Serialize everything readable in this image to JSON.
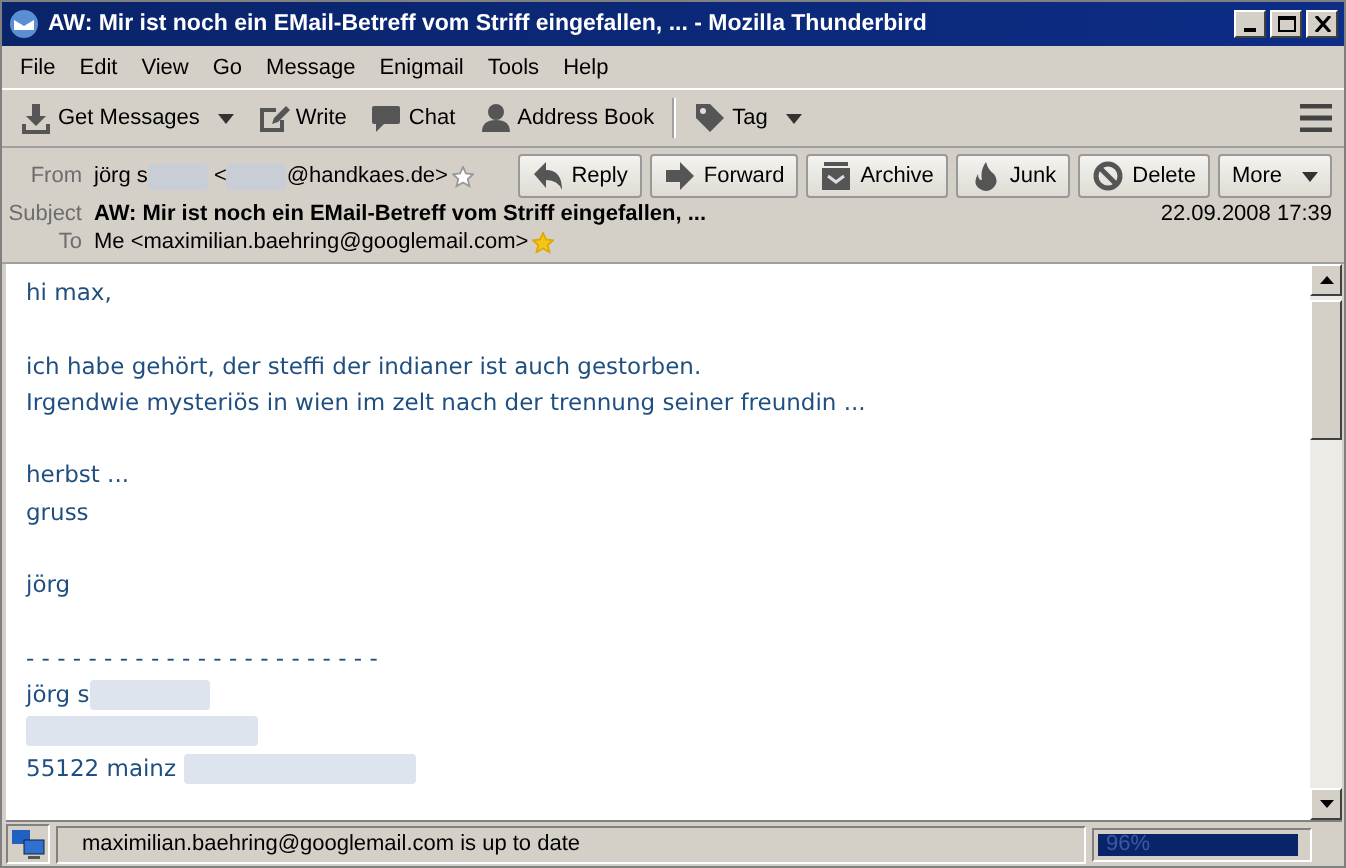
{
  "window": {
    "title": "AW: Mir ist noch ein EMail-Betreff vom Striff eingefallen, ... - Mozilla Thunderbird"
  },
  "menu": [
    {
      "label": "File"
    },
    {
      "label": "Edit"
    },
    {
      "label": "View"
    },
    {
      "label": "Go"
    },
    {
      "label": "Message"
    },
    {
      "label": "Enigmail"
    },
    {
      "label": "Tools"
    },
    {
      "label": "Help"
    }
  ],
  "toolbar": [
    {
      "kind": "download",
      "label": "Get Messages",
      "dropdown": true
    },
    {
      "kind": "pencil",
      "label": "Write",
      "dropdown": false
    },
    {
      "kind": "chat",
      "label": "Chat",
      "dropdown": false
    },
    {
      "kind": "person",
      "label": "Address Book",
      "dropdown": false
    },
    {
      "kind": "tag",
      "label": "Tag",
      "dropdown": true
    }
  ],
  "header": {
    "from_label": "From",
    "from": [
      {
        "kind": "text",
        "text": "jörg s"
      },
      {
        "kind": "redacted"
      },
      {
        "kind": "text",
        "text": " <"
      },
      {
        "kind": "redacted"
      },
      {
        "kind": "text",
        "text": "@handkaes.de>"
      }
    ],
    "from_starred": false,
    "actions": [
      {
        "kind": "reply",
        "label": "Reply"
      },
      {
        "kind": "forward",
        "label": "Forward"
      },
      {
        "kind": "archive",
        "label": "Archive"
      },
      {
        "kind": "junk",
        "label": "Junk"
      },
      {
        "kind": "delete",
        "label": "Delete"
      },
      {
        "kind": "more",
        "label": "More"
      }
    ],
    "subject_label": "Subject",
    "subject": "AW: Mir ist noch ein EMail-Betreff vom Striff eingefallen, ...",
    "date": "22.09.2008 17:39",
    "to_label": "To",
    "to": "Me <maximilian.baehring@googlemail.com>",
    "to_starred": true
  },
  "body": [
    [
      {
        "kind": "text",
        "text": "hi max,"
      }
    ],
    [
      {
        "kind": "blank"
      }
    ],
    [
      {
        "kind": "text",
        "text": "ich habe gehört, der steffi der indianer ist auch gestorben."
      }
    ],
    [
      {
        "kind": "text",
        "text": "Irgendwie mysteriös in wien im zelt nach der trennung seiner freundin ..."
      }
    ],
    [
      {
        "kind": "blank"
      }
    ],
    [
      {
        "kind": "text",
        "text": "herbst ..."
      }
    ],
    [
      {
        "kind": "text",
        "text": "gruss"
      }
    ],
    [
      {
        "kind": "blank"
      }
    ],
    [
      {
        "kind": "text",
        "text": "jörg"
      }
    ],
    [
      {
        "kind": "blank"
      }
    ],
    [
      {
        "kind": "text",
        "text": "- - - - - - - - - - - - - - - - - - - - - - -"
      }
    ],
    [
      {
        "kind": "text",
        "text": "jörg s"
      },
      {
        "kind": "redacted"
      }
    ],
    [
      {
        "kind": "redacted"
      }
    ],
    [
      {
        "kind": "text",
        "text": "55122 mainz "
      },
      {
        "kind": "redacted"
      }
    ]
  ],
  "status_bar": {
    "text": "maximilian.baehring@googlemail.com is up to date",
    "progress": {
      "level": 0.96,
      "label": "96%"
    }
  }
}
